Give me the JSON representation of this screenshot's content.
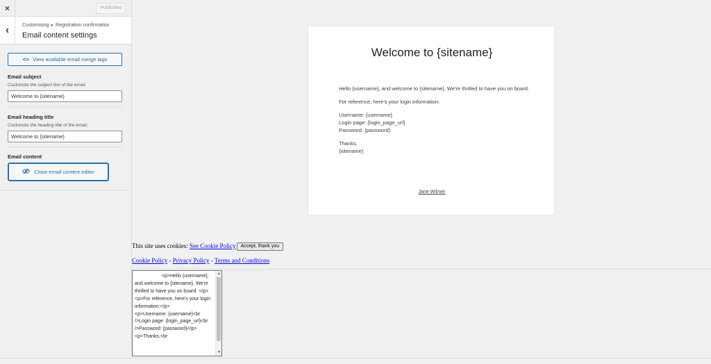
{
  "topbar": {
    "close_label": "×",
    "publish_label": "Published"
  },
  "section": {
    "back_label": "‹",
    "breadcrumb": [
      "Customising",
      "Registration confirmation"
    ],
    "breadcrumb_sep": "▸",
    "title": "Email content settings"
  },
  "merge_tags": {
    "icon": "code-icon",
    "icon_glyph": "<>",
    "label": "View available email merge tags"
  },
  "fields": {
    "subject": {
      "label": "Email subject",
      "description": "Customize the subject line of the email.",
      "value": "Welcome to {sitename}"
    },
    "heading": {
      "label": "Email heading title",
      "description": "Customize the heading title of the email.",
      "value": "Welcome to {sitename}"
    },
    "content": {
      "label": "Email content",
      "toggle_icon": "eye-slash-icon",
      "toggle_label": "Close email content editor"
    }
  },
  "email": {
    "heading": "Welcome to {sitename}",
    "paragraphs": [
      "Hello {username}, and welcome to {sitename}. We're thrilled to have you on board.",
      "For reference, here's your login information:",
      "Username: {username}",
      "Login page: {login_page_url}",
      "Password: {password}",
      "Thanks,",
      "{sitename}"
    ],
    "footer": "Jane Wilmer"
  },
  "cookie": {
    "text": "This site uses cookies: ",
    "link": "See Cookie Policy",
    "button": "Accept, thank you"
  },
  "footer_links": [
    "Cookie Policy",
    "Privacy Policy",
    "Terms and Conditions"
  ],
  "footer_sep": " - ",
  "code_editor": {
    "content": "                    <p>Hello {username}, and welcome to {sitename}. We're thrilled to have you on board. </p>\n<p>For reference, here's your login information:</p>\n<p>Username: {username}<br />Login page: {login_page_url}<br />Password: {password}</p>\n<p>Thanks,<br"
  },
  "colors": {
    "accent": "#2271b1",
    "link": "#0000ee",
    "sidebar_bg": "#f0f0f1"
  }
}
